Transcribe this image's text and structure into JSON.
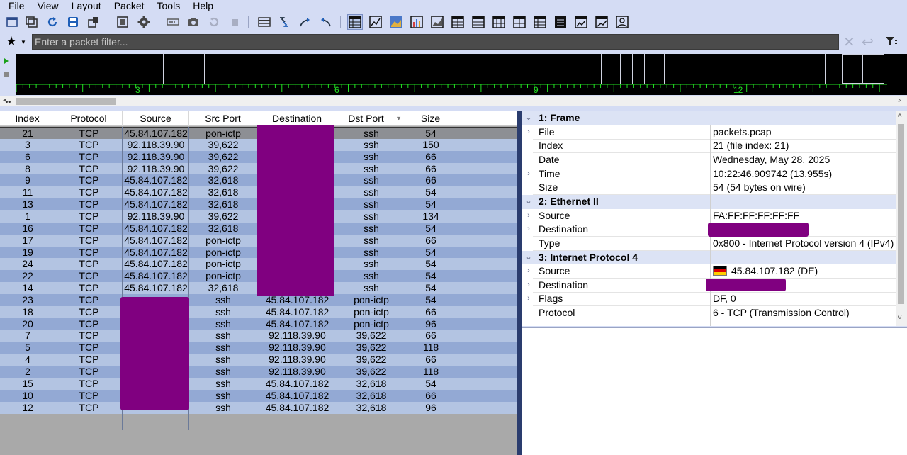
{
  "menu": [
    "File",
    "View",
    "Layout",
    "Packet",
    "Tools",
    "Help"
  ],
  "toolbar_icons": [
    "open-icon",
    "open-recent-icon",
    "reload-icon",
    "save-icon",
    "export-icon",
    "capture-options-icon",
    "settings-icon",
    "hex-icon",
    "screenshot-icon",
    "undo-icon",
    "stop-icon",
    "list-view-icon",
    "merge-icon",
    "arrow-right-icon",
    "arrow-left-icon",
    "grid-1-icon",
    "grid-2-icon",
    "grid-3-icon",
    "grid-4-icon",
    "grid-5-icon",
    "grid-6-icon",
    "grid-7-icon",
    "grid-8-icon",
    "grid-9-icon",
    "grid-10-icon",
    "grid-11-icon",
    "grid-12-icon",
    "profile-icon"
  ],
  "filter": {
    "placeholder": "Enter a packet filter..."
  },
  "timeline": {
    "labels": [
      "3",
      "6",
      "9",
      "12"
    ]
  },
  "columns": [
    "Index",
    "Protocol",
    "Source",
    "Src Port",
    "Destination",
    "Dst Port",
    "Size"
  ],
  "packets": [
    {
      "index": "21",
      "protocol": "TCP",
      "source": "45.84.107.182",
      "src_port": "pon-ictp",
      "destination": "",
      "dst_port": "ssh",
      "size": "54"
    },
    {
      "index": "3",
      "protocol": "TCP",
      "source": "92.118.39.90",
      "src_port": "39,622",
      "destination": "",
      "dst_port": "ssh",
      "size": "150"
    },
    {
      "index": "6",
      "protocol": "TCP",
      "source": "92.118.39.90",
      "src_port": "39,622",
      "destination": "",
      "dst_port": "ssh",
      "size": "66"
    },
    {
      "index": "8",
      "protocol": "TCP",
      "source": "92.118.39.90",
      "src_port": "39,622",
      "destination": "",
      "dst_port": "ssh",
      "size": "66"
    },
    {
      "index": "9",
      "protocol": "TCP",
      "source": "45.84.107.182",
      "src_port": "32,618",
      "destination": "",
      "dst_port": "ssh",
      "size": "66"
    },
    {
      "index": "11",
      "protocol": "TCP",
      "source": "45.84.107.182",
      "src_port": "32,618",
      "destination": "",
      "dst_port": "ssh",
      "size": "54"
    },
    {
      "index": "13",
      "protocol": "TCP",
      "source": "45.84.107.182",
      "src_port": "32,618",
      "destination": "",
      "dst_port": "ssh",
      "size": "54"
    },
    {
      "index": "1",
      "protocol": "TCP",
      "source": "92.118.39.90",
      "src_port": "39,622",
      "destination": "",
      "dst_port": "ssh",
      "size": "134"
    },
    {
      "index": "16",
      "protocol": "TCP",
      "source": "45.84.107.182",
      "src_port": "32,618",
      "destination": "",
      "dst_port": "ssh",
      "size": "54"
    },
    {
      "index": "17",
      "protocol": "TCP",
      "source": "45.84.107.182",
      "src_port": "pon-ictp",
      "destination": "",
      "dst_port": "ssh",
      "size": "66"
    },
    {
      "index": "19",
      "protocol": "TCP",
      "source": "45.84.107.182",
      "src_port": "pon-ictp",
      "destination": "",
      "dst_port": "ssh",
      "size": "54"
    },
    {
      "index": "24",
      "protocol": "TCP",
      "source": "45.84.107.182",
      "src_port": "pon-ictp",
      "destination": "",
      "dst_port": "ssh",
      "size": "54"
    },
    {
      "index": "22",
      "protocol": "TCP",
      "source": "45.84.107.182",
      "src_port": "pon-ictp",
      "destination": "",
      "dst_port": "ssh",
      "size": "54"
    },
    {
      "index": "14",
      "protocol": "TCP",
      "source": "45.84.107.182",
      "src_port": "32,618",
      "destination": "",
      "dst_port": "ssh",
      "size": "54"
    },
    {
      "index": "23",
      "protocol": "TCP",
      "source": "",
      "src_port": "ssh",
      "destination": "45.84.107.182",
      "dst_port": "pon-ictp",
      "size": "54"
    },
    {
      "index": "18",
      "protocol": "TCP",
      "source": "",
      "src_port": "ssh",
      "destination": "45.84.107.182",
      "dst_port": "pon-ictp",
      "size": "66"
    },
    {
      "index": "20",
      "protocol": "TCP",
      "source": "",
      "src_port": "ssh",
      "destination": "45.84.107.182",
      "dst_port": "pon-ictp",
      "size": "96"
    },
    {
      "index": "7",
      "protocol": "TCP",
      "source": "",
      "src_port": "ssh",
      "destination": "92.118.39.90",
      "dst_port": "39,622",
      "size": "66"
    },
    {
      "index": "5",
      "protocol": "TCP",
      "source": "",
      "src_port": "ssh",
      "destination": "92.118.39.90",
      "dst_port": "39,622",
      "size": "118"
    },
    {
      "index": "4",
      "protocol": "TCP",
      "source": "",
      "src_port": "ssh",
      "destination": "92.118.39.90",
      "dst_port": "39,622",
      "size": "66"
    },
    {
      "index": "2",
      "protocol": "TCP",
      "source": "",
      "src_port": "ssh",
      "destination": "92.118.39.90",
      "dst_port": "39,622",
      "size": "118"
    },
    {
      "index": "15",
      "protocol": "TCP",
      "source": "",
      "src_port": "ssh",
      "destination": "45.84.107.182",
      "dst_port": "32,618",
      "size": "54"
    },
    {
      "index": "10",
      "protocol": "TCP",
      "source": "",
      "src_port": "ssh",
      "destination": "45.84.107.182",
      "dst_port": "32,618",
      "size": "66"
    },
    {
      "index": "12",
      "protocol": "TCP",
      "source": "",
      "src_port": "ssh",
      "destination": "45.84.107.182",
      "dst_port": "32,618",
      "size": "96"
    }
  ],
  "details": [
    {
      "type": "head",
      "label": "1: Frame",
      "chevron": "down"
    },
    {
      "type": "item",
      "label": "File",
      "value": "packets.pcap",
      "chevron": "right"
    },
    {
      "type": "item",
      "label": "Index",
      "value": "21 (file index: 21)",
      "chevron": ""
    },
    {
      "type": "item",
      "label": "Date",
      "value": "Wednesday, May 28, 2025",
      "chevron": ""
    },
    {
      "type": "item",
      "label": "Time",
      "value": "10:22:46.909742 (13.955s)",
      "chevron": "right"
    },
    {
      "type": "item",
      "label": "Size",
      "value": "54 (54 bytes on wire)",
      "chevron": ""
    },
    {
      "type": "head",
      "label": "2: Ethernet II",
      "chevron": "down"
    },
    {
      "type": "item",
      "label": "Source",
      "value": "FA:FF:FF:FF:FF:FF",
      "chevron": "right"
    },
    {
      "type": "item",
      "label": "Destination",
      "value": "",
      "chevron": "right"
    },
    {
      "type": "item",
      "label": "Type",
      "value": "0x800 - Internet Protocol version 4 (IPv4)",
      "chevron": ""
    },
    {
      "type": "head",
      "label": "3: Internet Protocol 4",
      "chevron": "down"
    },
    {
      "type": "item",
      "label": "Source",
      "value": "45.84.107.182 (DE)",
      "chevron": "right",
      "flag": "DE"
    },
    {
      "type": "item",
      "label": "Destination",
      "value": "",
      "chevron": "right"
    },
    {
      "type": "item",
      "label": "Flags",
      "value": "DF, 0",
      "chevron": "right"
    },
    {
      "type": "item",
      "label": "Protocol",
      "value": "6 - TCP (Transmission Control)",
      "chevron": ""
    }
  ],
  "colors": {
    "redaction": "#800080",
    "row_dark": "#93a9d4",
    "row_light": "#b3c4e2",
    "row_selected": "#8d8f94",
    "timeline_bg": "#000000",
    "timeline_label": "#22e022"
  }
}
